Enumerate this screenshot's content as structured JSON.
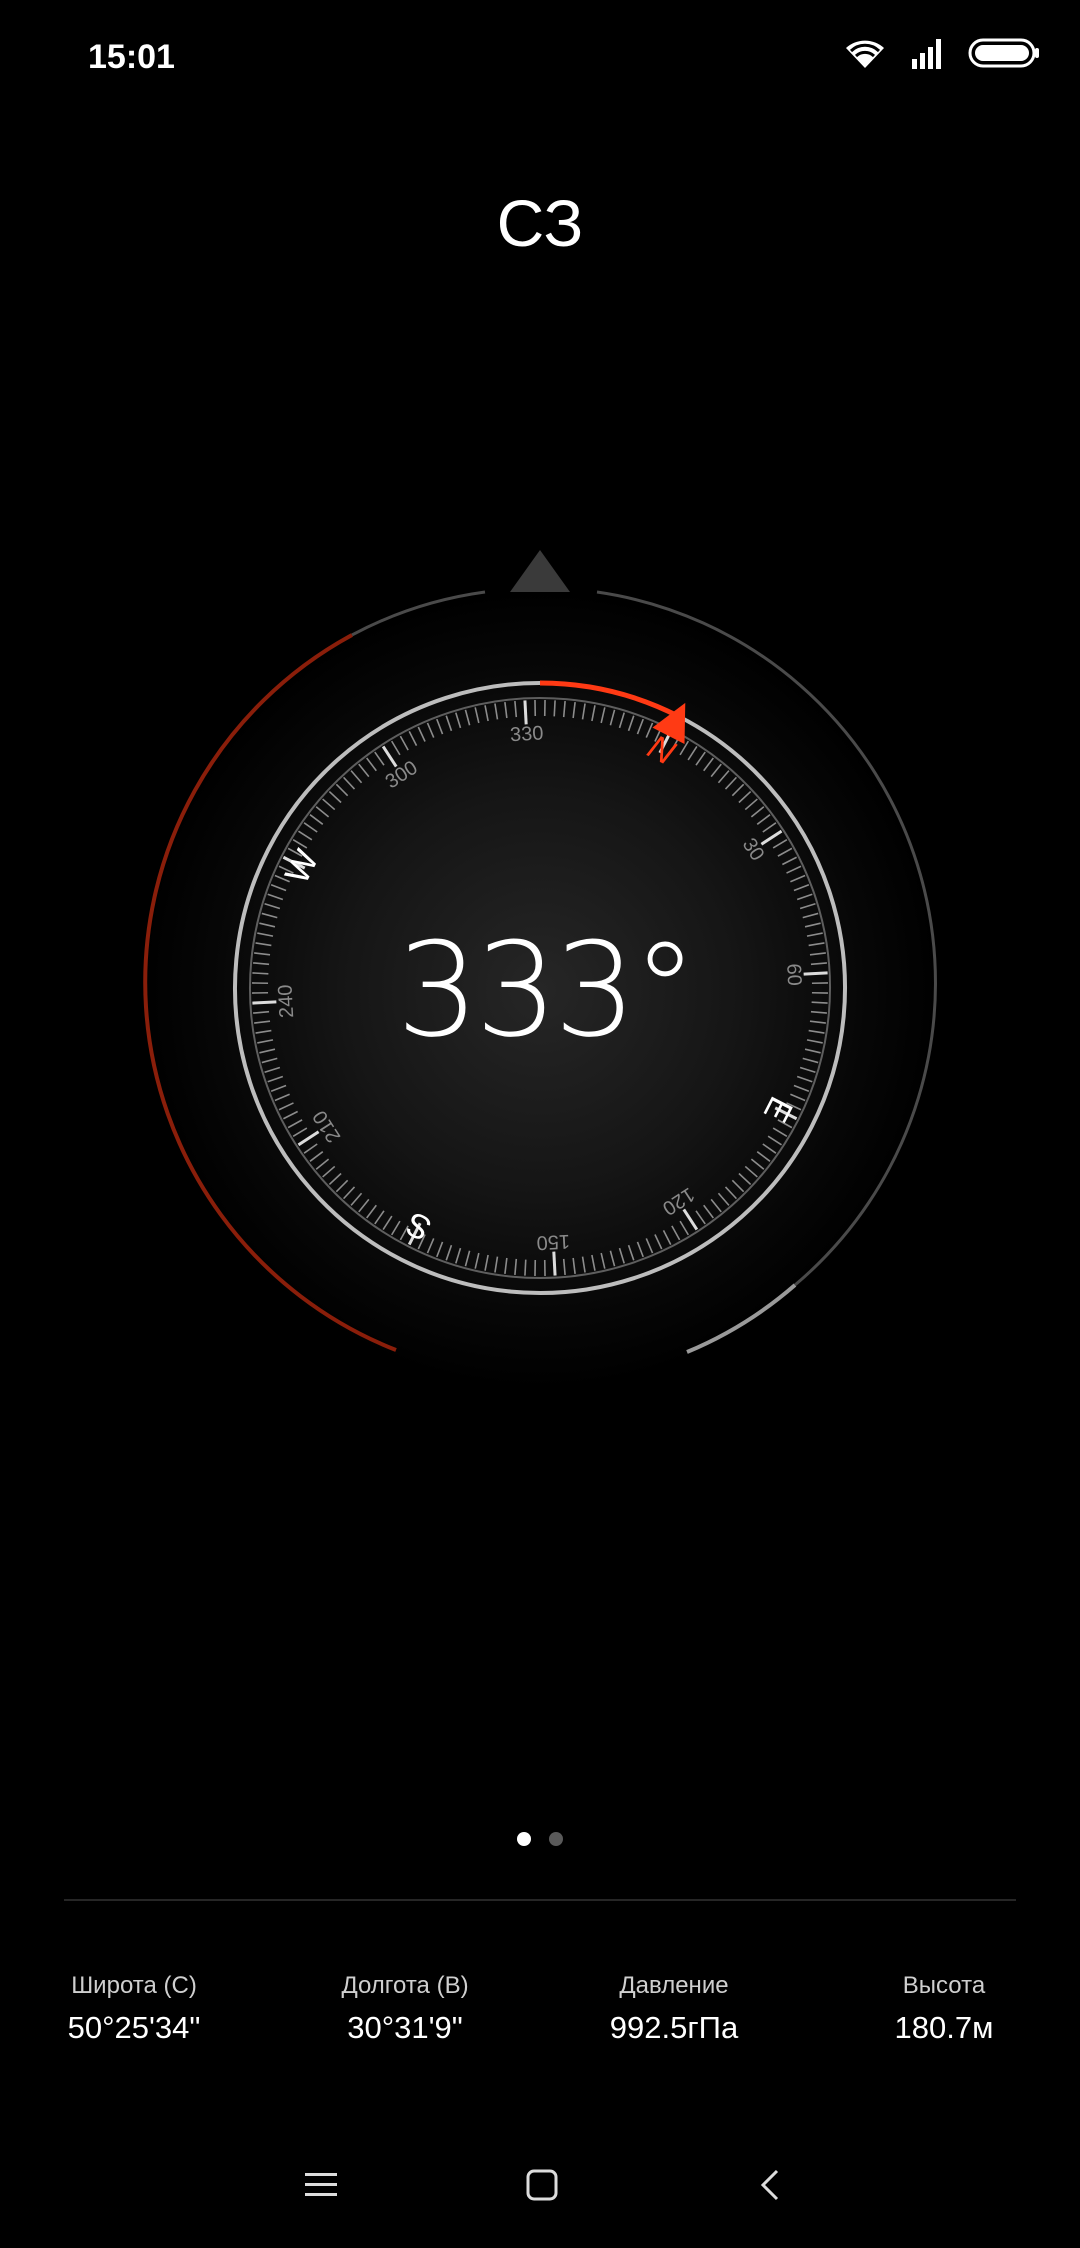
{
  "status": {
    "time": "15:01",
    "icons": [
      "wifi-icon",
      "signal-icon",
      "battery-icon"
    ]
  },
  "compass": {
    "direction_label": "СЗ",
    "heading_deg": 333,
    "heading_text": "333°",
    "cardinals": {
      "N": "N",
      "E": "E",
      "S": "S",
      "W": "W"
    },
    "ticks": {
      "t30": "30",
      "t60": "60",
      "t120": "120",
      "t150": "150",
      "t210": "210",
      "t240": "240",
      "t300": "300",
      "t330": "330"
    },
    "colors": {
      "accent": "#ff3a14",
      "ring": "#9a9a9a",
      "dial": "#c8c8c8"
    }
  },
  "pager": {
    "count": 2,
    "active": 0
  },
  "info": [
    {
      "label": "Широта (С)",
      "value": "50°25'34\""
    },
    {
      "label": "Долгота (В)",
      "value": "30°31'9\""
    },
    {
      "label": "Давление",
      "value": "992.5гПа"
    },
    {
      "label": "Высота",
      "value": "180.7м"
    }
  ],
  "nav": {
    "icons": [
      "menu-icon",
      "home-icon",
      "back-icon"
    ]
  }
}
